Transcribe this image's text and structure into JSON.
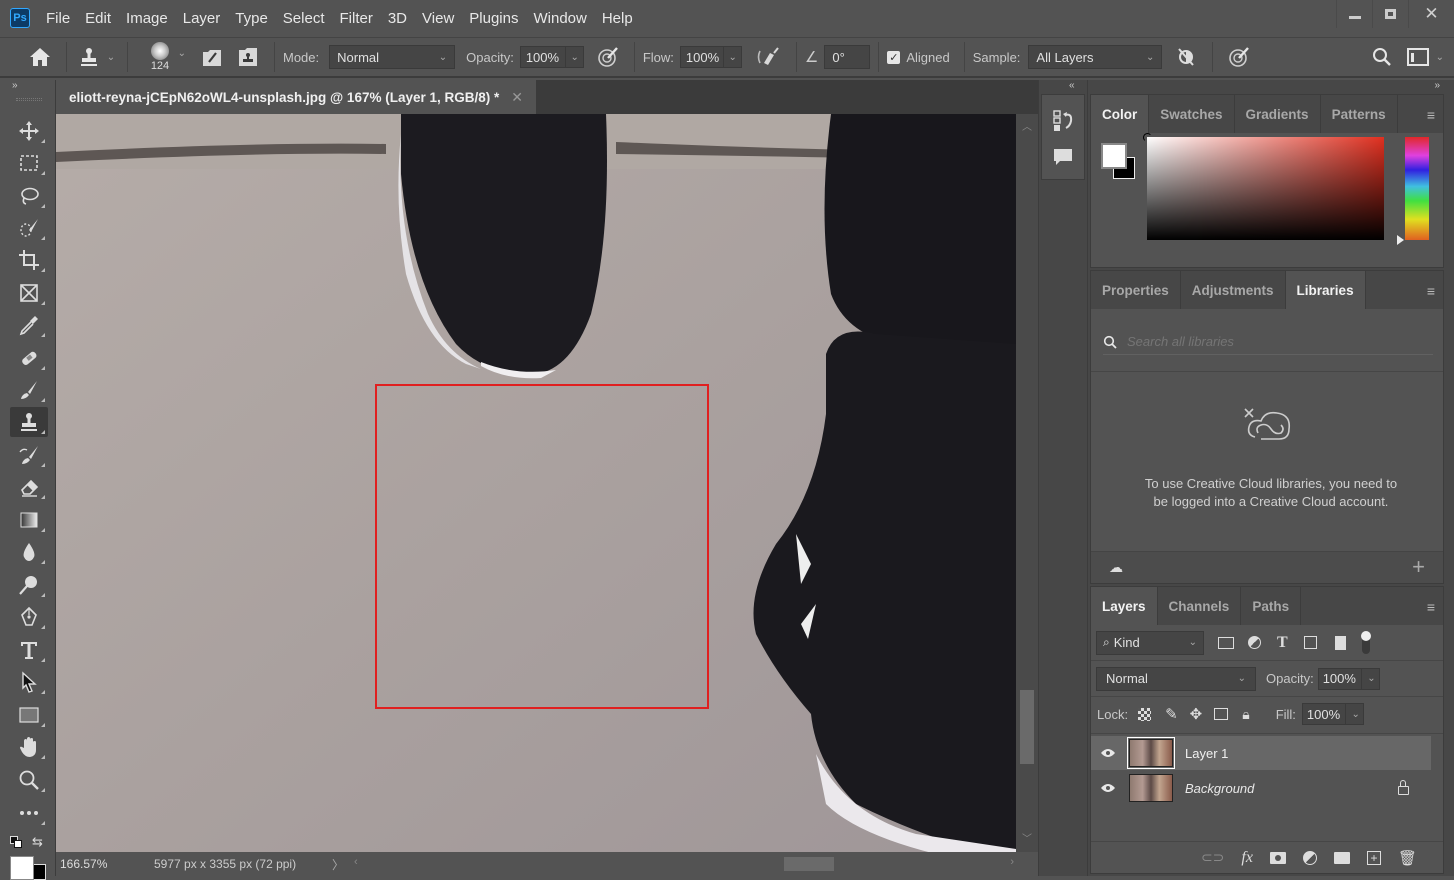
{
  "app": {
    "logo": "Ps"
  },
  "menu": [
    "File",
    "Edit",
    "Image",
    "Layer",
    "Type",
    "Select",
    "Filter",
    "3D",
    "View",
    "Plugins",
    "Window",
    "Help"
  ],
  "window_controls": {
    "minimize": "minimize-icon",
    "restore": "restore-icon",
    "close": "close-icon"
  },
  "options": {
    "brush_size": "124",
    "mode_label": "Mode:",
    "mode_value": "Normal",
    "opacity_label": "Opacity:",
    "opacity_value": "100%",
    "flow_label": "Flow:",
    "flow_value": "100%",
    "angle_value": "0°",
    "aligned_label": "Aligned",
    "aligned_checked": true,
    "sample_label": "Sample:",
    "sample_value": "All Layers"
  },
  "document": {
    "tab_title": "eliott-reyna-jCEpN62oWL4-unsplash.jpg @ 167% (Layer 1, RGB/8) *",
    "zoom": "166.57%",
    "dimensions": "5977 px x 3355 px (72 ppi)",
    "selection_color": "#e02020"
  },
  "tools": [
    "move",
    "rectangular-marquee",
    "lasso",
    "quick-selection",
    "crop",
    "frame",
    "eyedropper",
    "healing-brush",
    "brush",
    "clone-stamp",
    "history-brush",
    "eraser",
    "gradient",
    "blur",
    "dodge",
    "pen",
    "type",
    "path-selection",
    "rectangle",
    "hand",
    "zoom",
    "more-tools"
  ],
  "color_panel": {
    "tabs": [
      "Color",
      "Swatches",
      "Gradients",
      "Patterns"
    ],
    "active_tab": "Color",
    "foreground": "#ffffff",
    "background": "#000000",
    "hue_color": "#e03020"
  },
  "props_panel": {
    "tabs": [
      "Properties",
      "Adjustments",
      "Libraries"
    ],
    "active_tab": "Libraries",
    "search_placeholder": "Search all libraries",
    "message": "To use Creative Cloud libraries, you need to be logged into a Creative Cloud account."
  },
  "layers_panel": {
    "tabs": [
      "Layers",
      "Channels",
      "Paths"
    ],
    "active_tab": "Layers",
    "filter_kind": "Kind",
    "blend_mode": "Normal",
    "opacity_label": "Opacity:",
    "opacity_value": "100%",
    "lock_label": "Lock:",
    "fill_label": "Fill:",
    "fill_value": "100%",
    "layers": [
      {
        "name": "Layer 1",
        "visible": true,
        "selected": true,
        "locked": false
      },
      {
        "name": "Background",
        "visible": true,
        "selected": false,
        "locked": true
      }
    ]
  }
}
